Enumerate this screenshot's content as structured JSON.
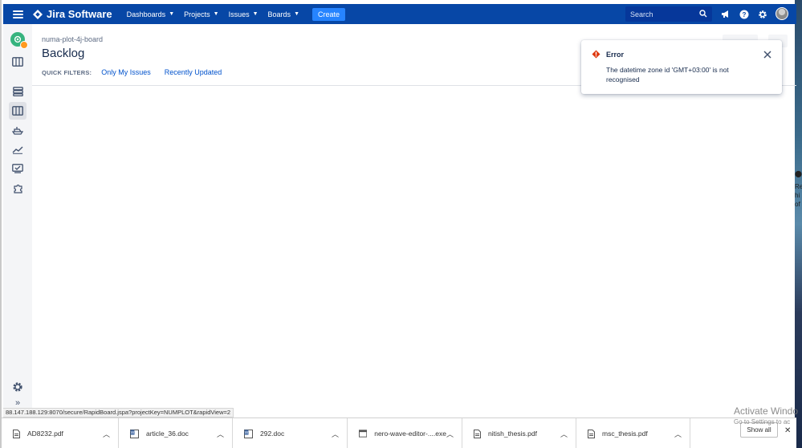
{
  "topnav": {
    "product_name": "Jira Software",
    "items": [
      {
        "label": "Dashboards"
      },
      {
        "label": "Projects"
      },
      {
        "label": "Issues"
      },
      {
        "label": "Boards"
      }
    ],
    "create_label": "Create",
    "search_placeholder": "Search"
  },
  "board": {
    "breadcrumb": "numa-plot-4j-board",
    "title": "Backlog",
    "quick_filters_label": "QUICK FILTERS:",
    "filters": [
      "Only My Issues",
      "Recently Updated"
    ]
  },
  "error_flag": {
    "title": "Error",
    "message": "The datetime zone id 'GMT+03:00' is not recognised"
  },
  "status_bar_url": "88.147.188.129:8070/secure/RapidBoard.jspa?projectKey=NUMPLOT&rapidView=2",
  "downloads": [
    {
      "name": "AD8232.pdf",
      "icon": "pdf-file-icon"
    },
    {
      "name": "article_36.doc",
      "icon": "doc-file-icon"
    },
    {
      "name": "292.doc",
      "icon": "doc-file-icon"
    },
    {
      "name": "nero-wave-editor-....exe",
      "icon": "exe-file-icon"
    },
    {
      "name": "nitish_thesis.pdf",
      "icon": "pdf-file-icon"
    },
    {
      "name": "msc_thesis.pdf",
      "icon": "pdf-file-icon"
    }
  ],
  "show_all_label": "Show all",
  "watermark": {
    "line1": "Activate Windo",
    "line2": "Go to Settings to ac"
  },
  "colors": {
    "nav_blue": "#0747a6",
    "create_blue": "#2684ff",
    "link_blue": "#0052cc",
    "error_red": "#de350b"
  }
}
